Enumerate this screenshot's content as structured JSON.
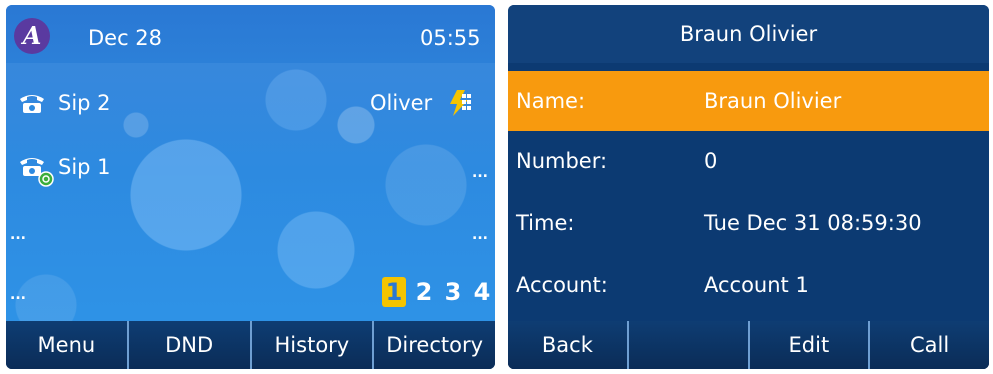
{
  "idle_screen": {
    "date": "Dec 28",
    "time": "05:55",
    "accounts": [
      {
        "label": "Sip 2",
        "status": "Oliver"
      },
      {
        "label": "Sip 1",
        "status": "..."
      }
    ],
    "empty_lines": [
      "...",
      "...",
      "..."
    ],
    "pages": [
      "1",
      "2",
      "3",
      "4"
    ],
    "active_page": "1",
    "softkeys": [
      "Menu",
      "DND",
      "History",
      "Directory"
    ],
    "colors": {
      "accent": "#f5c400",
      "background": "#2d8ae0",
      "softkey_bar": "#0d2f5c"
    }
  },
  "detail_screen": {
    "title": "Braun Olivier",
    "fields": [
      {
        "label": "Name:",
        "value": "Braun Olivier"
      },
      {
        "label": "Number:",
        "value": "0"
      },
      {
        "label": "Time:",
        "value": "Tue Dec 31 08:59:30"
      },
      {
        "label": "Account:",
        "value": "Account 1"
      }
    ],
    "selected_field": "Name:",
    "softkeys": [
      "Back",
      "",
      "Edit",
      "Call"
    ],
    "colors": {
      "background": "#0c3a72",
      "selection": "#f89a0e"
    }
  }
}
